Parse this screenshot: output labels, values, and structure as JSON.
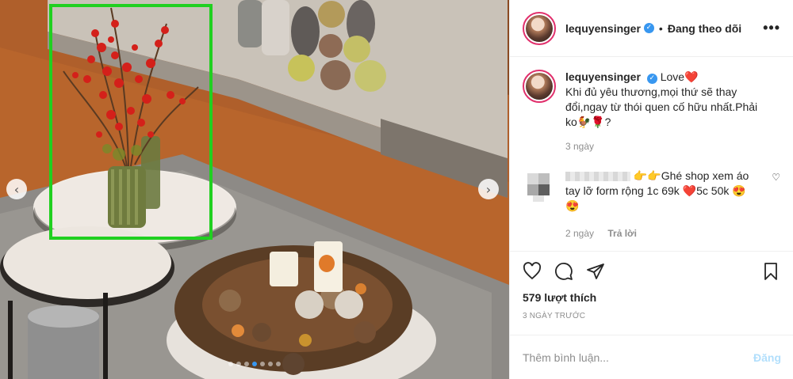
{
  "post": {
    "slide_count": 7,
    "active_slide": 4,
    "highlight_color": "#20d020"
  },
  "header": {
    "username": "lequyensinger",
    "separator": "•",
    "follow_label": "Đang theo dõi",
    "more_label": "•••"
  },
  "caption": {
    "username": "lequyensinger",
    "first_line": "Love❤️",
    "text": "Khi đủ yêu thương,mọi thứ sẽ thay đổi,ngay từ thói quen cố hữu nhất.Phải ko🐓🌹?",
    "time": "3 ngày"
  },
  "comment": {
    "text": "👉👉Ghé shop xem áo tay lỡ form rộng 1c 69k ❤️5c 50k 😍😍",
    "time": "2 ngày",
    "reply_label": "Trả lời"
  },
  "stats": {
    "likes": "579 lượt thích",
    "date": "3 NGÀY TRƯỚC"
  },
  "add_comment": {
    "placeholder": "Thêm bình luận...",
    "post_label": "Đăng"
  }
}
